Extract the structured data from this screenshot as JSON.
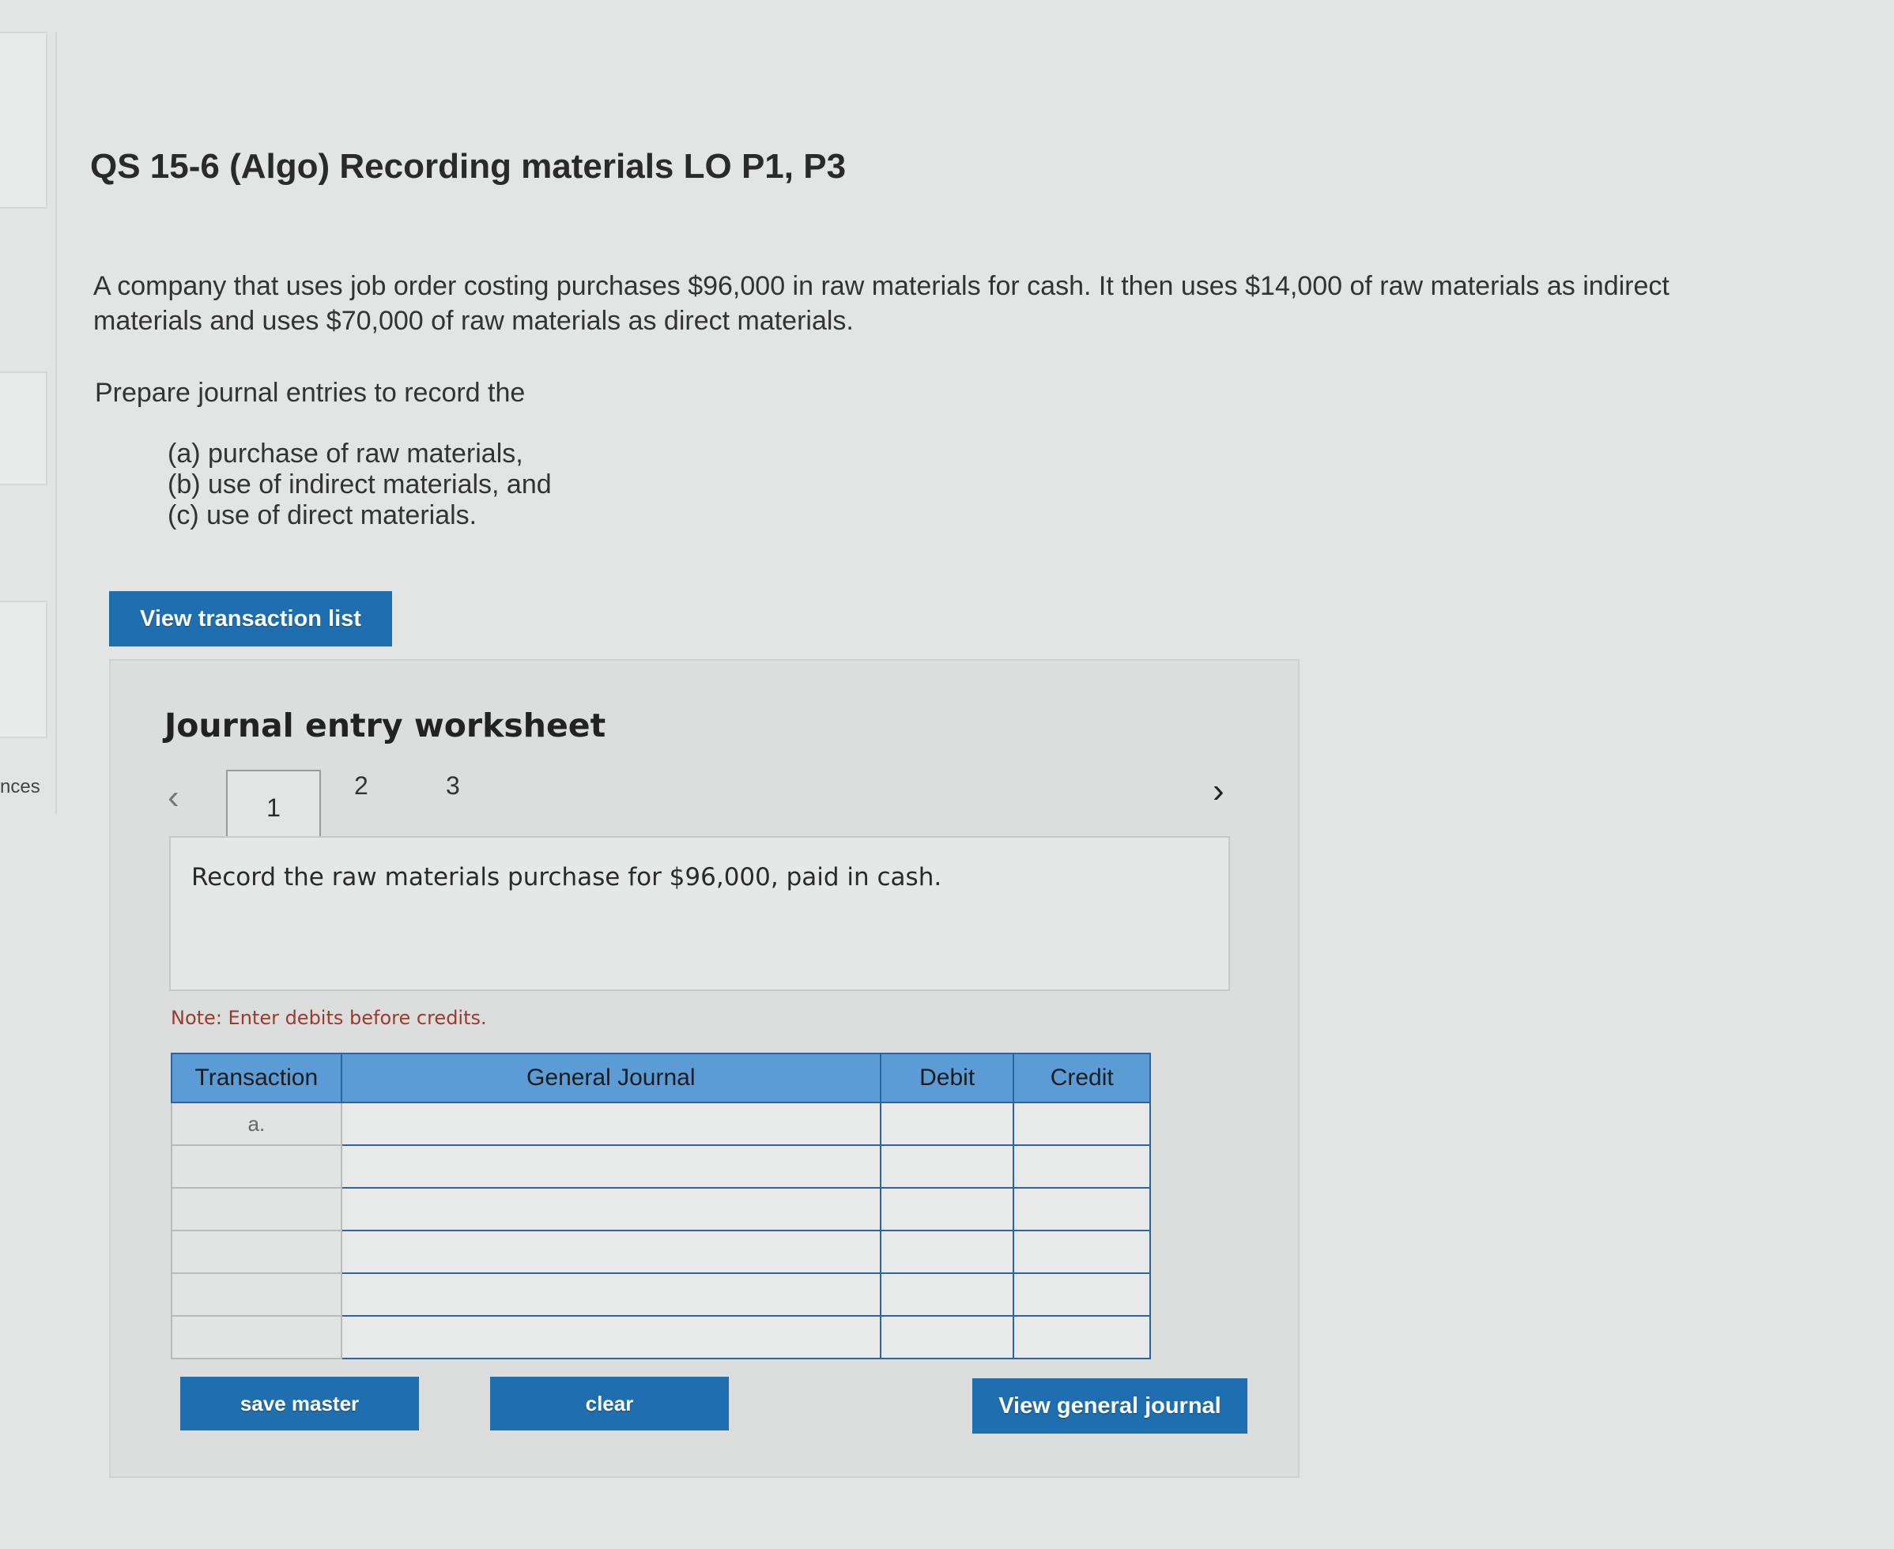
{
  "rail": {
    "label": "nces"
  },
  "question": {
    "title": "QS 15-6 (Algo) Recording materials LO P1, P3",
    "intro_line1": "A company that uses job order costing purchases $96,000 in raw materials for cash. It then uses $14,000 of raw materials as indirect",
    "intro_line2": "materials and uses $70,000 of raw materials as direct materials.",
    "prepare": "Prepare journal entries to record the",
    "parts": [
      "(a) purchase of raw materials,",
      "(b) use of indirect materials, and",
      "(c) use of direct materials."
    ]
  },
  "buttons": {
    "view_transaction_list": "View transaction list",
    "save_master": "save master",
    "clear": "clear",
    "view_general_journal": "View general journal"
  },
  "worksheet": {
    "title": "Journal entry worksheet",
    "tabs": [
      "1",
      "2",
      "3"
    ],
    "active_tab": "1",
    "instruction": "Record the raw materials purchase for $96,000, paid in cash.",
    "note": "Note: Enter debits before credits.",
    "columns": [
      "Transaction",
      "General Journal",
      "Debit",
      "Credit"
    ],
    "rows": [
      {
        "transaction": "a."
      },
      {
        "transaction": ""
      },
      {
        "transaction": ""
      },
      {
        "transaction": ""
      },
      {
        "transaction": ""
      },
      {
        "transaction": ""
      }
    ]
  }
}
